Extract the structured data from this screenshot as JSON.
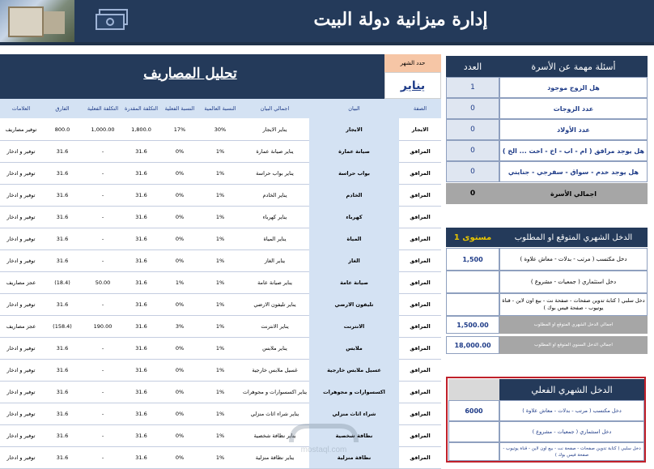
{
  "header": {
    "title": "إدارة ميزانية دولة البيت"
  },
  "family": {
    "header_questions": "أسئلة مهمة عن الأسرة",
    "header_count": "العدد",
    "rows": [
      {
        "q": "هل الزوج موجود",
        "v": "1"
      },
      {
        "q": "عدد الزوجات",
        "v": "0"
      },
      {
        "q": "عدد الأولاد",
        "v": "0"
      },
      {
        "q": "هل يوجد مرافق ( ام - اب - اخ - اخت ... الخ )",
        "v": "0"
      },
      {
        "q": "هل يوجد خدم - سواق - سفرجي - جنايني",
        "v": "0"
      }
    ],
    "total_label": "اجمالي الأسرة",
    "total_value": "0"
  },
  "expected_income": {
    "header": "الدخل الشهري المتوقع او المطلوب",
    "level": "مستوى 1",
    "rows": [
      {
        "label": "دخل مكتسب ( مرتب - بدلات - معاش علاوة )",
        "value": "1,500"
      },
      {
        "label": "دخل استثماري ( جمعيات - مشروع )",
        "value": ""
      },
      {
        "label": "دخل سلبي ( كتابة تدوين صفحات - صفحة نت - بيع اون لاين - قناة يوتيوب - صفحة فيس بوك )",
        "value": ""
      },
      {
        "label": "اجمالي الدخل الشهري المتوقع او المطلوب",
        "value": "1,500.00"
      },
      {
        "label": "اجمالي الدخل السنوي المتوقع او المطلوب",
        "value": "18,000.00"
      }
    ]
  },
  "actual_income": {
    "header": "الدخل الشهري الفعلي",
    "rows": [
      {
        "label": "دخل مكتسب ( مرتب - بدلات - معاش علاوة )",
        "value": "6000"
      },
      {
        "label": "دخل استثماري ( جمعيات - مشروع )",
        "value": ""
      },
      {
        "label": "دخل سلبي ( كتابة تدوين صفحات - صفحة نت - بيع اون لاين - قناة يوتيوب - صفحة فيس بوك )",
        "value": ""
      }
    ]
  },
  "month": {
    "label": "حدد الشهر",
    "value": "يناير"
  },
  "expenses": {
    "title": "تحليل المصاريف",
    "columns": [
      "الصفة",
      "البيان",
      "اجمالي البيان",
      "النسبة العالمية",
      "النسبة الفعلية",
      "التكلفة المقدرة",
      "التكلفة الفعلية",
      "الفارق",
      "العلامات"
    ],
    "rows": [
      [
        "الايجار",
        "الايجار",
        "يناير الايجار",
        "30%",
        "17%",
        "1,800.0",
        "1,000.00",
        "800.0",
        "توفير مصاريف"
      ],
      [
        "المرافق",
        "صيانة عمارة",
        "يناير صيانة عمارة",
        "1%",
        "0%",
        "31.6",
        "-",
        "31.6",
        "توفير و ادخار"
      ],
      [
        "المرافق",
        "بواب حراسة",
        "يناير بواب حراسة",
        "1%",
        "0%",
        "31.6",
        "-",
        "31.6",
        "توفير و ادخار"
      ],
      [
        "المرافق",
        "الخادم",
        "يناير الخادم",
        "1%",
        "0%",
        "31.6",
        "-",
        "31.6",
        "توفير و ادخار"
      ],
      [
        "المرافق",
        "كهرباء",
        "يناير كهرباء",
        "1%",
        "0%",
        "31.6",
        "-",
        "31.6",
        "توفير و ادخار"
      ],
      [
        "المرافق",
        "المياة",
        "يناير المياة",
        "1%",
        "0%",
        "31.6",
        "-",
        "31.6",
        "توفير و ادخار"
      ],
      [
        "المرافق",
        "الغاز",
        "يناير الغاز",
        "1%",
        "0%",
        "31.6",
        "-",
        "31.6",
        "توفير و ادخار"
      ],
      [
        "المرافق",
        "صيانة عامة",
        "يناير صيانة عامة",
        "1%",
        "1%",
        "31.6",
        "50.00",
        "(18.4)",
        "عجز مصاريف"
      ],
      [
        "المرافق",
        "تليفون الارضي",
        "يناير تليفون الارضي",
        "1%",
        "0%",
        "31.6",
        "-",
        "31.6",
        "توفير و ادخار"
      ],
      [
        "المرافق",
        "الانترنت",
        "يناير الانترنت",
        "1%",
        "3%",
        "31.6",
        "190.00",
        "(158.4)",
        "عجز مصاريف"
      ],
      [
        "المرافق",
        "ملابس",
        "يناير ملابس",
        "1%",
        "0%",
        "31.6",
        "-",
        "31.6",
        "توفير و ادخار"
      ],
      [
        "المرافق",
        "غسيل ملابس خارجية",
        "غسيل ملابس خارجية",
        "1%",
        "0%",
        "31.6",
        "-",
        "31.6",
        "توفير و ادخار"
      ],
      [
        "المرافق",
        "اكسسوارات و مجوهرات",
        "يناير اكسسوارات و مجوهرات",
        "1%",
        "0%",
        "31.6",
        "-",
        "31.6",
        "توفير و ادخار"
      ],
      [
        "المرافق",
        "شراء اثاث منزلي",
        "يناير شراء اثاث منزلي",
        "1%",
        "0%",
        "31.6",
        "-",
        "31.6",
        "توفير و ادخار"
      ],
      [
        "المرافق",
        "نظافة شخصية",
        "يناير نظافة شخصية",
        "1%",
        "0%",
        "31.6",
        "-",
        "31.6",
        "توفير و ادخار"
      ],
      [
        "المرافق",
        "نظافة منزلية",
        "يناير نظافة منزلية",
        "1%",
        "0%",
        "31.6",
        "-",
        "31.6",
        "توفير و ادخار"
      ]
    ]
  },
  "watermark": {
    "text": "mostaql.com"
  },
  "colors": {
    "navy": "#243a5a",
    "light_blue": "#d4e2f3",
    "gray": "#a6a6a6",
    "red_border": "#c0202a",
    "gold": "#c8a400"
  }
}
